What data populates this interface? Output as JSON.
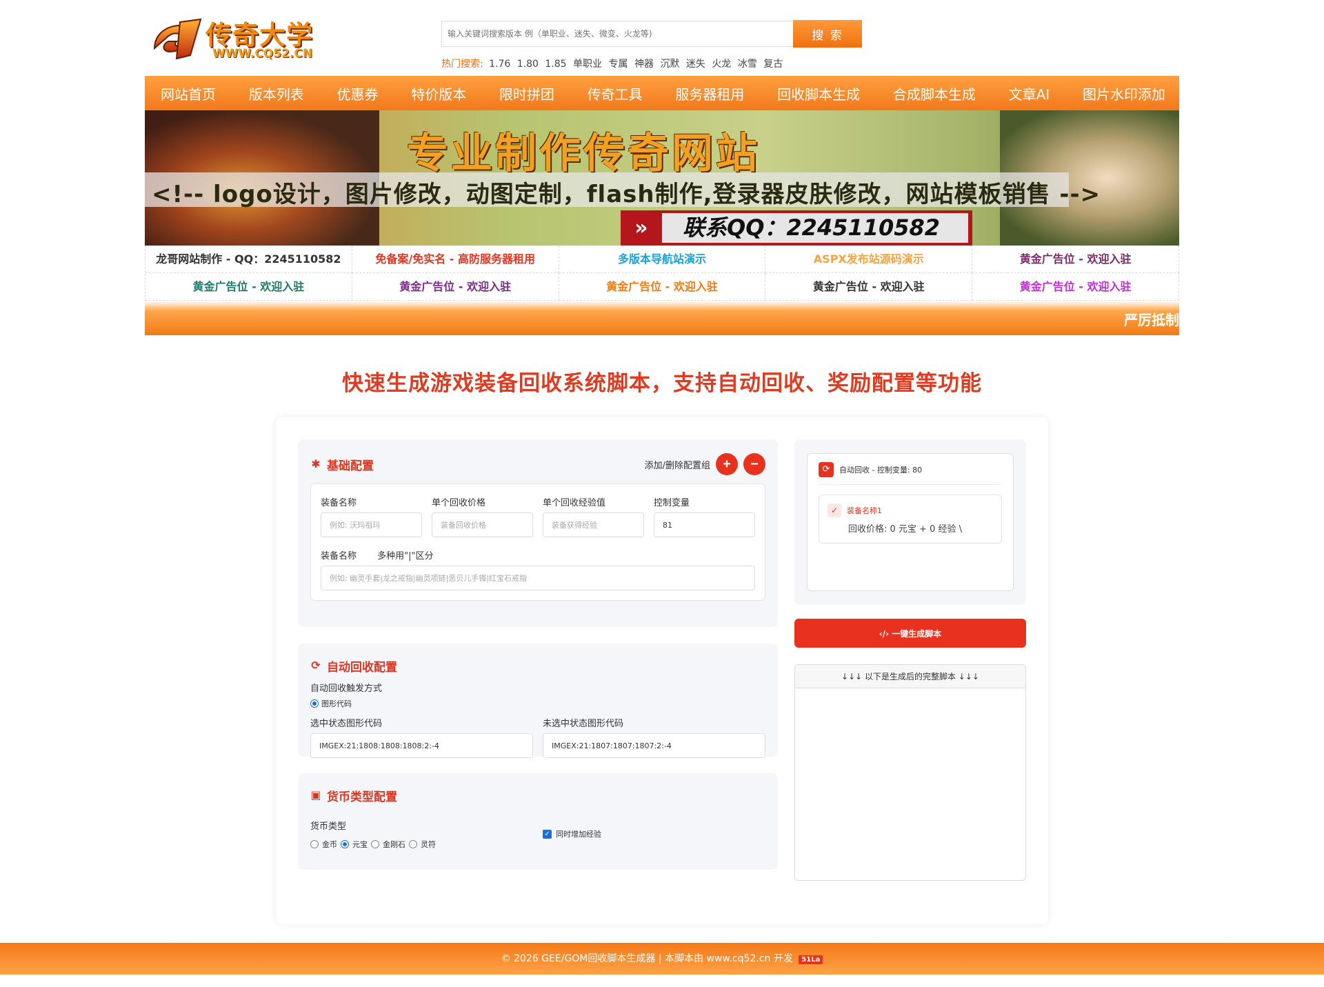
{
  "header": {
    "logo_text": "传奇大学",
    "logo_url": "WWW.CQ52.CN",
    "search_placeholder": "输入关键词搜索版本 例（单职业、迷失、微变、火龙等)",
    "search_button": "搜 索",
    "hot_label": "热门搜索:",
    "hot_items": [
      "1.76",
      "1.80",
      "1.85",
      "单职业",
      "专属",
      "神器",
      "沉默",
      "迷失",
      "火龙",
      "冰雪",
      "复古"
    ]
  },
  "nav": [
    "网站首页",
    "版本列表",
    "优惠券",
    "特价版本",
    "限时拼团",
    "传奇工具",
    "服务器租用",
    "回收脚本生成",
    "合成脚本生成",
    "文章AI",
    "图片水印添加"
  ],
  "banner": {
    "title": "专业制作传奇网站",
    "subtitle": "<!-- logo设计，图片修改，动图定制，flash制作,登录器皮肤修改，网站模板销售 -->",
    "qq": "联系QQ：2245110582"
  },
  "ads": [
    {
      "text": "龙哥网站制作 - QQ：2245110582",
      "color": "#333333"
    },
    {
      "text": "免备案/免实名 - 高防服务器租用",
      "color": "#e8321e"
    },
    {
      "text": "多版本导航站演示",
      "color": "#1aa3d8"
    },
    {
      "text": "ASPX发布站源码演示",
      "color": "#f4a340"
    },
    {
      "text": "黄金广告位 - 欢迎入驻",
      "color": "#7a2a6a"
    },
    {
      "text": "黄金广告位 - 欢迎入驻",
      "color": "#1a7a6a"
    },
    {
      "text": "黄金广告位 - 欢迎入驻",
      "color": "#7a2a8a"
    },
    {
      "text": "黄金广告位 - 欢迎入驻",
      "color": "#f07a10"
    },
    {
      "text": "黄金广告位 - 欢迎入驻",
      "color": "#333333"
    },
    {
      "text": "黄金广告位 - 欢迎入驻",
      "color": "#c02ad8"
    }
  ],
  "ticker": "严厉抵制",
  "page_title": "快速生成游戏装备回收系统脚本，支持自动回收、奖励配置等功能",
  "basic": {
    "title": "基础配置",
    "add_remove_label": "添加/删除配置组",
    "add_btn": "+",
    "remove_btn": "−",
    "fields": [
      {
        "label": "装备名称",
        "placeholder": "例如: 沃玛祖玛",
        "value": ""
      },
      {
        "label": "单个回收价格",
        "placeholder": "装备回收价格",
        "value": ""
      },
      {
        "label": "单个回收经验值",
        "placeholder": "装备获得经验",
        "value": ""
      },
      {
        "label": "控制变量",
        "placeholder": "",
        "value": "81"
      }
    ],
    "names_label": "装备名称",
    "names_hint": "多种用\"|\"区分",
    "names_placeholder": "例如: 幽灵手套|龙之戒指|幽灵项链|恶贝儿手镯|红宝石戒指"
  },
  "auto": {
    "title": "自动回收配置",
    "trigger_label": "自动回收触发方式",
    "trigger_option": "图形代码",
    "selected_label": "选中状态图形代码",
    "selected_value": "IMGEX:21:1808:1808:1808:2:-4",
    "unselected_label": "未选中状态图形代码",
    "unselected_value": "IMGEX:21:1807:1807:1807:2:-4"
  },
  "currency": {
    "title": "货币类型配置",
    "type_label": "货币类型",
    "options": [
      "金币",
      "元宝",
      "金刚石",
      "灵符"
    ],
    "selected": "元宝",
    "add_exp_label": "同时增加经验"
  },
  "preview": {
    "head": "自动回收 - 控制变量: 80",
    "item_name": "装备名称1",
    "item_price": "回收价格: 0 元宝 + 0 经验 \\"
  },
  "generate_button": "一键生成脚本",
  "output_head": "↓↓↓ 以下是生成后的完整脚本 ↓↓↓",
  "footer": {
    "text": "© 2026 GEE/GOM回收脚本生成器 | 本脚本由 www.cq52.cn 开发",
    "badge": "51La"
  }
}
